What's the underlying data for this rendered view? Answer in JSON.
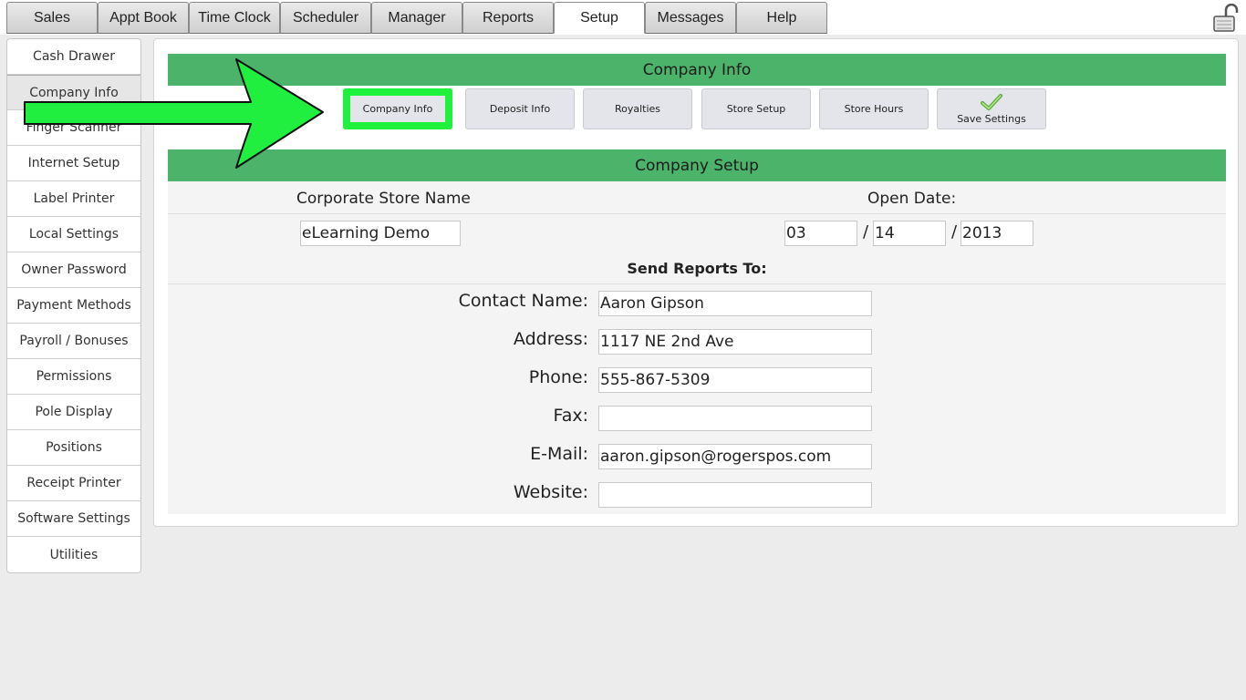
{
  "top_tabs": [
    {
      "label": "Sales"
    },
    {
      "label": "Appt Book"
    },
    {
      "label": "Time Clock"
    },
    {
      "label": "Scheduler"
    },
    {
      "label": "Manager"
    },
    {
      "label": "Reports"
    },
    {
      "label": "Setup",
      "active": true
    },
    {
      "label": "Messages"
    },
    {
      "label": "Help"
    }
  ],
  "lock_icon": "padlock-icon",
  "sidebar": {
    "items": [
      {
        "label": "Cash Drawer"
      },
      {
        "label": "Company Info",
        "active": true
      },
      {
        "label": "Finger Scanner"
      },
      {
        "label": "Internet Setup"
      },
      {
        "label": "Label Printer"
      },
      {
        "label": "Local Settings"
      },
      {
        "label": "Owner Password"
      },
      {
        "label": "Payment Methods"
      },
      {
        "label": "Payroll / Bonuses"
      },
      {
        "label": "Permissions"
      },
      {
        "label": "Pole Display"
      },
      {
        "label": "Positions"
      },
      {
        "label": "Receipt Printer"
      },
      {
        "label": "Software Settings"
      },
      {
        "label": "Utilities"
      }
    ]
  },
  "main": {
    "header_title": "Company Info",
    "subtabs": [
      {
        "label": "Company Info",
        "highlighted": true
      },
      {
        "label": "Deposit Info"
      },
      {
        "label": "Royalties"
      },
      {
        "label": "Store Setup"
      },
      {
        "label": "Store Hours"
      },
      {
        "label": "Save Settings",
        "icon": "checkmark-icon"
      }
    ],
    "section_title": "Company Setup",
    "store_name_label": "Corporate Store Name",
    "store_name_value": "eLearning Demo",
    "open_date_label": "Open Date:",
    "open_date": {
      "month": "03",
      "day": "14",
      "year": "2013",
      "separator": "/"
    },
    "send_reports_label": "Send Reports To:",
    "contact": {
      "name_label": "Contact Name:",
      "name_value": "Aaron Gipson",
      "address_label": "Address:",
      "address_value": "1117 NE 2nd Ave",
      "phone_label": "Phone:",
      "phone_value": "555-867-5309",
      "fax_label": "Fax:",
      "fax_value": "",
      "email_label": "E-Mail:",
      "email_value": "aaron.gipson@rogerspos.com",
      "website_label": "Website:",
      "website_value": ""
    }
  },
  "colors": {
    "header_green": "#4cb36a",
    "highlight_green": "#1ef23c",
    "arrow_green": "#20ef3f"
  }
}
